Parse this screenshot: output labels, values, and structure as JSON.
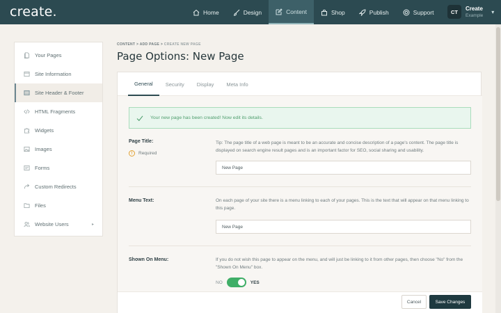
{
  "app": {
    "logo": "create."
  },
  "nav": {
    "items": [
      {
        "label": "Home",
        "icon": "home-icon"
      },
      {
        "label": "Design",
        "icon": "brush-icon"
      },
      {
        "label": "Content",
        "icon": "edit-icon",
        "active": true
      },
      {
        "label": "Shop",
        "icon": "bag-icon"
      },
      {
        "label": "Publish",
        "icon": "rocket-icon"
      },
      {
        "label": "Support",
        "icon": "lifebuoy-icon"
      }
    ]
  },
  "user": {
    "initials": "CT",
    "name": "Create",
    "subtitle": "Example",
    "chevron": "▾"
  },
  "sidebar": {
    "items": [
      {
        "label": "Your Pages",
        "icon": "pages-icon"
      },
      {
        "label": "Site Information",
        "icon": "info-icon"
      },
      {
        "label": "Site Header & Footer",
        "icon": "layout-icon",
        "active": true
      },
      {
        "label": "HTML Fragments",
        "icon": "code-icon"
      },
      {
        "label": "Widgets",
        "icon": "puzzle-icon"
      },
      {
        "label": "Images",
        "icon": "image-icon"
      },
      {
        "label": "Forms",
        "icon": "form-icon"
      },
      {
        "label": "Custom Redirects",
        "icon": "redirect-icon"
      },
      {
        "label": "Files",
        "icon": "folder-icon"
      },
      {
        "label": "Website Users",
        "icon": "users-icon",
        "arrow": "▸"
      }
    ]
  },
  "breadcrumb": {
    "items": [
      "CONTENT",
      "ADD PAGE",
      "CREATE NEW PAGE"
    ],
    "separator": ">"
  },
  "page": {
    "title": "Page Options: New Page"
  },
  "tabs": [
    {
      "label": "General",
      "active": true
    },
    {
      "label": "Security"
    },
    {
      "label": "Display"
    },
    {
      "label": "Meta Info"
    }
  ],
  "alert": {
    "message": "Your new page has been created! Now edit its details.",
    "icon": "check-icon"
  },
  "fields": {
    "page_title": {
      "label": "Page Title:",
      "required_label": "Required",
      "required_icon": "!",
      "help": "Tip: The page title of a web page is meant to be an accurate and concise description of a page's content. The page title is displayed on search engine result pages and is an important factor for SEO, social sharing and usability.",
      "value": "New Page"
    },
    "menu_text": {
      "label": "Menu Text:",
      "help": "On each page of your site there is a menu linking to each of your pages. This is the text that will appear on that menu linking to this page.",
      "value": "New Page"
    },
    "shown_on_menu": {
      "label": "Shown On Menu:",
      "help": "If you do not wish this page to appear on the menu, and will just be linking to it from other pages, then choose \"No\" from the \"Shown On Menu\" box.",
      "off_label": "NO",
      "on_label": "YES",
      "value": true
    }
  },
  "footer": {
    "cancel_label": "Cancel",
    "save_label": "Save Changes"
  },
  "colors": {
    "topbar": "#2c4a51",
    "primary_button": "#1f3a40",
    "success": "#3fae67",
    "warning": "#e2a233"
  }
}
